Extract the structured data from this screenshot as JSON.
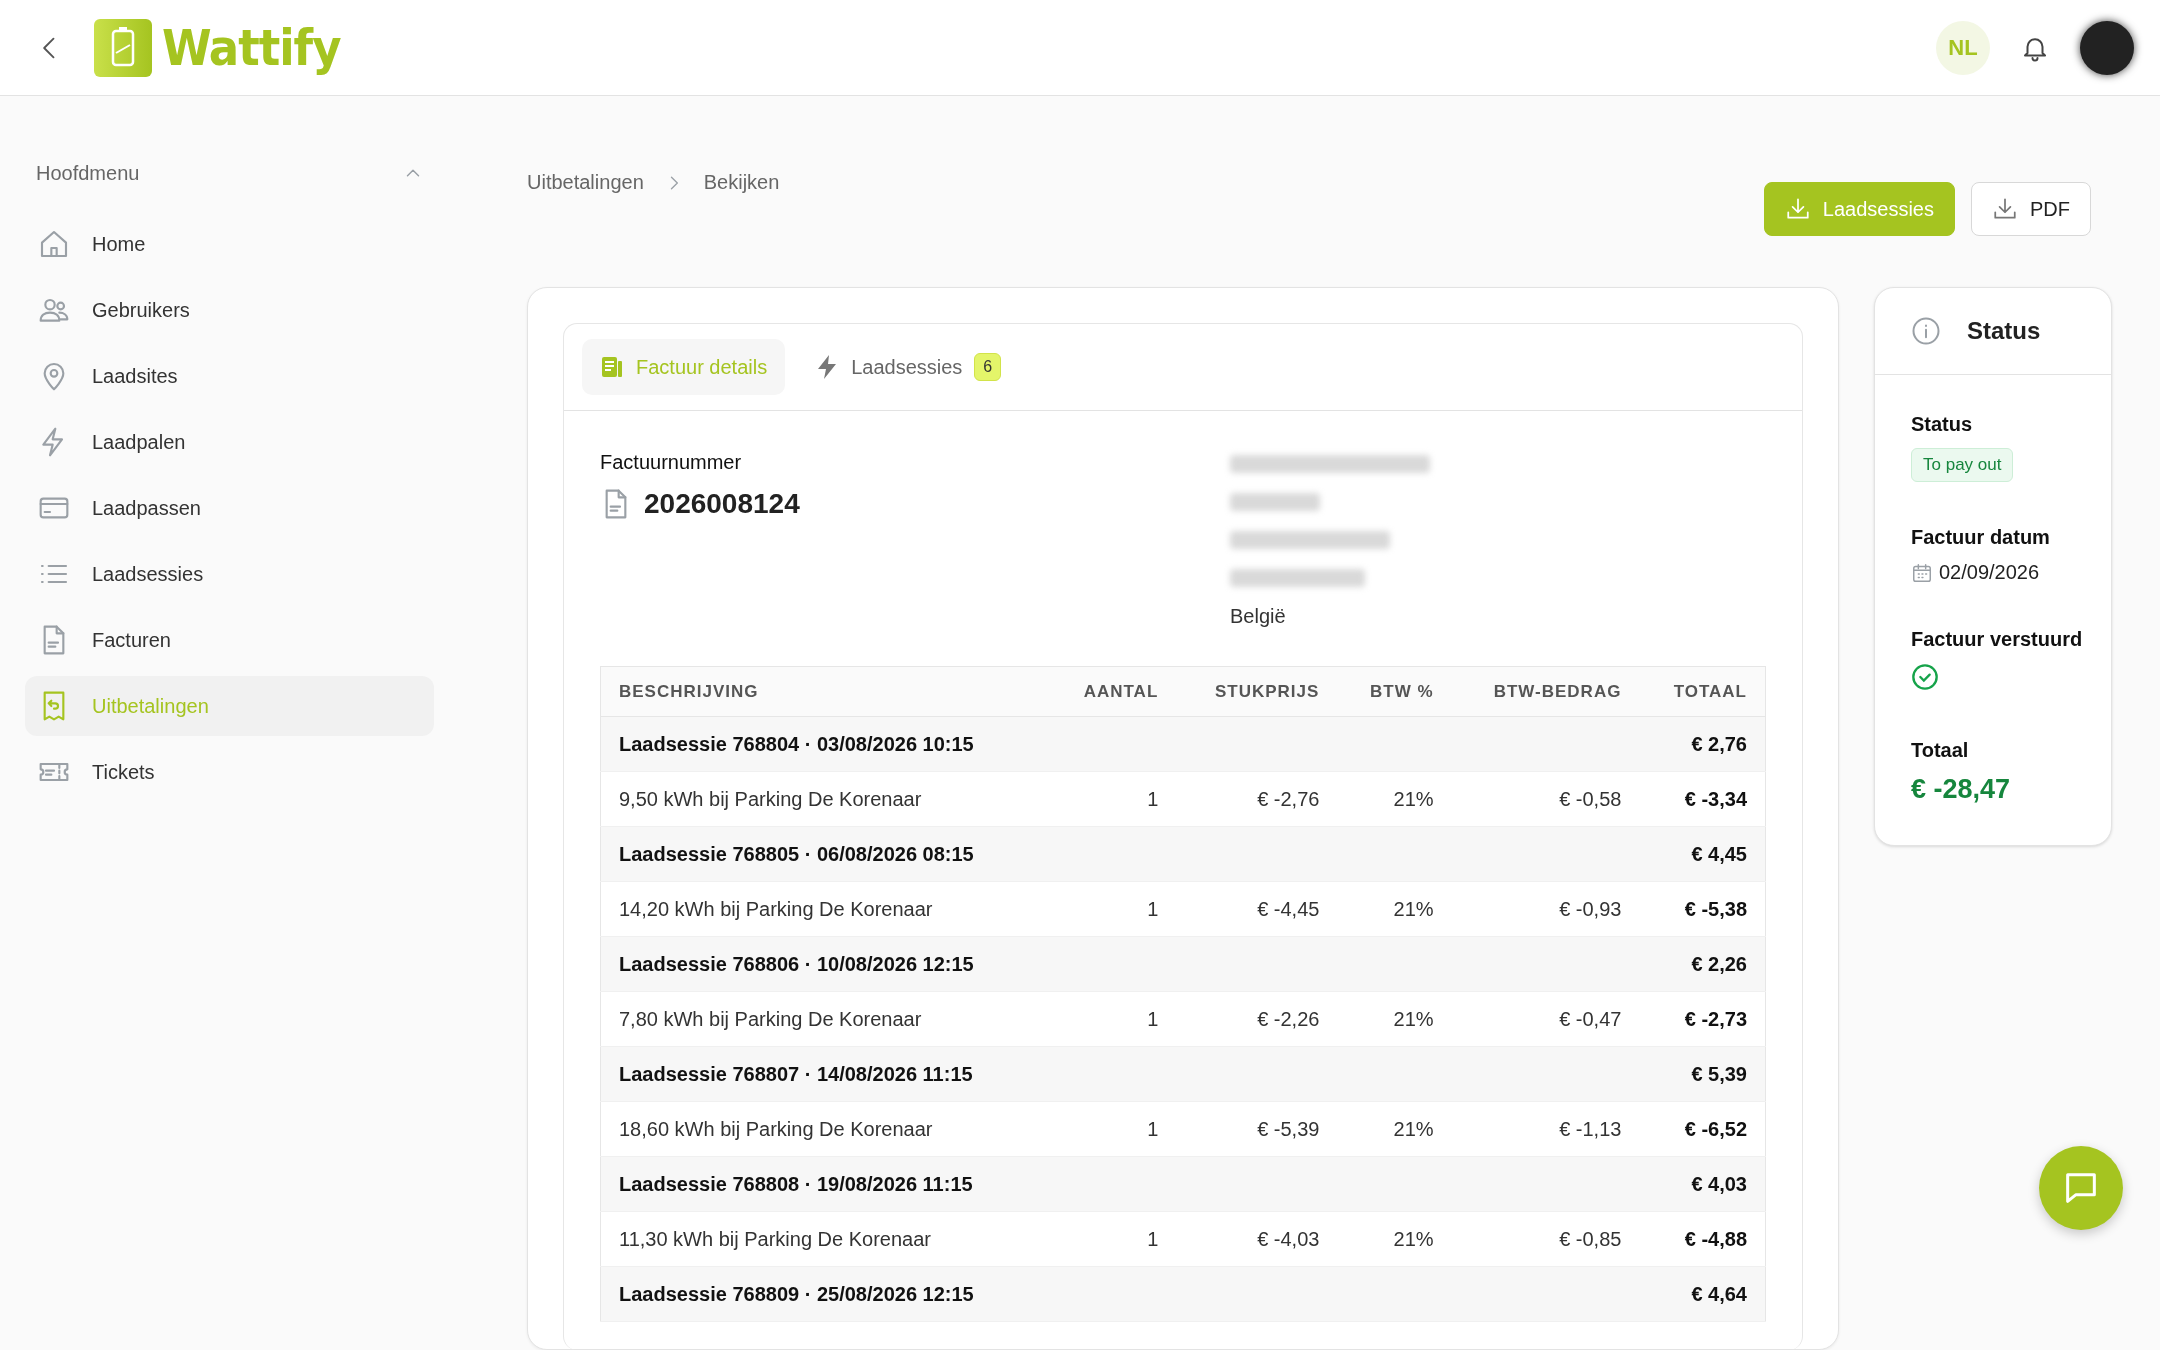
{
  "header": {
    "logo": "Wattify",
    "language": "NL"
  },
  "sidebar": {
    "title": "Hoofdmenu",
    "expanded": true,
    "items": [
      {
        "label": "Home",
        "selected": false
      },
      {
        "label": "Gebruikers",
        "selected": false
      },
      {
        "label": "Laadsites",
        "selected": false
      },
      {
        "label": "Laadpalen",
        "selected": false
      },
      {
        "label": "Laadpassen",
        "selected": false
      },
      {
        "label": "Laadsessies",
        "selected": false
      },
      {
        "label": "Facturen",
        "selected": false
      },
      {
        "label": "Uitbetalingen",
        "selected": true
      },
      {
        "label": "Tickets",
        "selected": false
      }
    ]
  },
  "breadcrumb": [
    "Uitbetalingen",
    "Bekijken"
  ],
  "actions": [
    {
      "label": "Laadsessies",
      "kind": "primary"
    },
    {
      "label": "PDF",
      "kind": "secondary"
    }
  ],
  "tabs": [
    {
      "label": "Factuur details",
      "selected": true
    },
    {
      "label": "Laadsessies",
      "selected": false,
      "badge": "6"
    }
  ],
  "invoice": {
    "number_label": "Factuurnummer",
    "number": "2026008124",
    "country": "België"
  },
  "table": {
    "columns": [
      "BESCHRIJVING",
      "AANTAL",
      "STUKPRIJS",
      "BTW %",
      "BTW-BEDRAG",
      "TOTAAL"
    ],
    "rows": [
      {
        "kind": "session",
        "description": "Laadsessie 768804 · 03/08/2026 10:15",
        "total": "€ 2,76"
      },
      {
        "kind": "line",
        "description": "9,50 kWh bij Parking De Korenaar",
        "quantity": "1",
        "unit_price": "€ -2,76",
        "vat_rate": "21%",
        "vat_amount": "€ -0,58",
        "total": "€ -3,34"
      },
      {
        "kind": "session",
        "description": "Laadsessie 768805 · 06/08/2026 08:15",
        "total": "€ 4,45"
      },
      {
        "kind": "line",
        "description": "14,20 kWh bij Parking De Korenaar",
        "quantity": "1",
        "unit_price": "€ -4,45",
        "vat_rate": "21%",
        "vat_amount": "€ -0,93",
        "total": "€ -5,38"
      },
      {
        "kind": "session",
        "description": "Laadsessie 768806 · 10/08/2026 12:15",
        "total": "€ 2,26"
      },
      {
        "kind": "line",
        "description": "7,80 kWh bij Parking De Korenaar",
        "quantity": "1",
        "unit_price": "€ -2,26",
        "vat_rate": "21%",
        "vat_amount": "€ -0,47",
        "total": "€ -2,73"
      },
      {
        "kind": "session",
        "description": "Laadsessie 768807 · 14/08/2026 11:15",
        "total": "€ 5,39"
      },
      {
        "kind": "line",
        "description": "18,60 kWh bij Parking De Korenaar",
        "quantity": "1",
        "unit_price": "€ -5,39",
        "vat_rate": "21%",
        "vat_amount": "€ -1,13",
        "total": "€ -6,52"
      },
      {
        "kind": "session",
        "description": "Laadsessie 768808 · 19/08/2026 11:15",
        "total": "€ 4,03"
      },
      {
        "kind": "line",
        "description": "11,30 kWh bij Parking De Korenaar",
        "quantity": "1",
        "unit_price": "€ -4,03",
        "vat_rate": "21%",
        "vat_amount": "€ -0,85",
        "total": "€ -4,88"
      },
      {
        "kind": "session",
        "description": "Laadsessie 768809 · 25/08/2026 12:15",
        "total": "€ 4,64"
      }
    ]
  },
  "status": {
    "title": "Status",
    "fields": [
      {
        "kind": "badge",
        "label": "Status",
        "value": "To pay out"
      },
      {
        "kind": "date",
        "label": "Factuur datum",
        "value": "02/09/2026"
      },
      {
        "kind": "check",
        "label": "Factuur verstuurd",
        "checked": true
      },
      {
        "kind": "amount",
        "label": "Totaal",
        "value": "€ -28,47"
      }
    ]
  }
}
